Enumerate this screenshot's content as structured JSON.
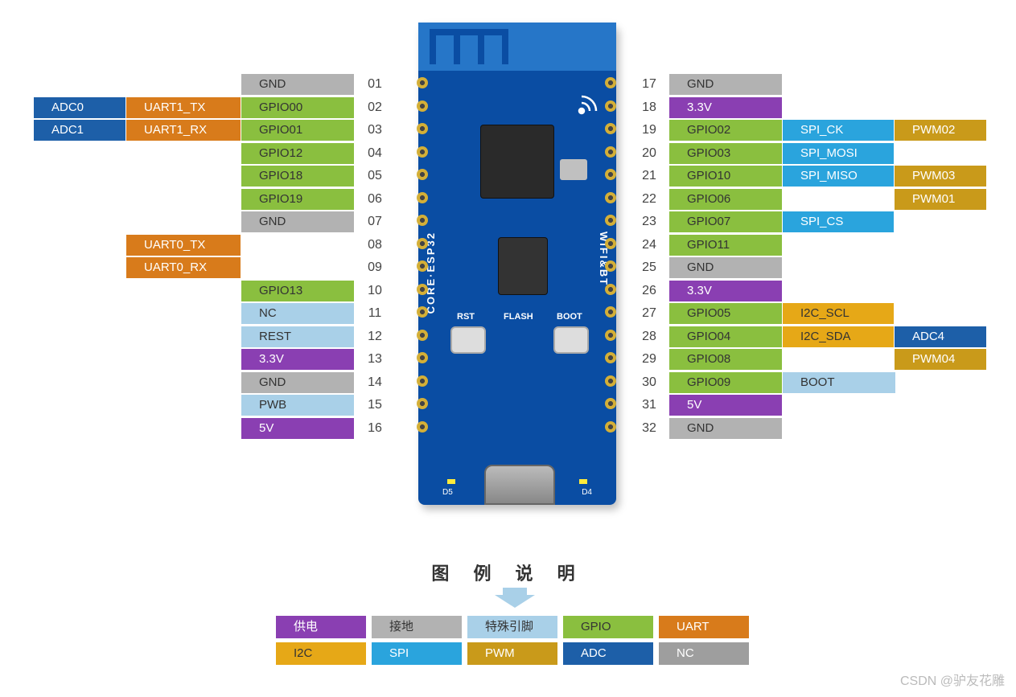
{
  "board": {
    "text_left": "CORE·ESP32",
    "text_right": "WIFI&BT",
    "btn_rst": "RST",
    "btn_flash": "FLASH",
    "btn_boot": "BOOT",
    "led_l": "D5",
    "led_r": "D4"
  },
  "colors": {
    "adc": "#1d5fa8",
    "uart": "#d87b1b",
    "gpio": "#8abf3f",
    "gnd": "#b2b2b2",
    "pwr": "#8a3fb2",
    "spec": "#a9d0e8",
    "i2c": "#e6a817",
    "spi": "#2aa4dd",
    "pwm": "#c99a1a",
    "nc": "#9e9e9e"
  },
  "left_pins": [
    {
      "num": "01",
      "cells": [
        {
          "t": "GND",
          "c": "gnd",
          "dark": true
        }
      ]
    },
    {
      "num": "02",
      "cells": [
        {
          "t": "ADC0",
          "c": "adc"
        },
        {
          "t": "UART1_TX",
          "c": "uart"
        },
        {
          "t": "GPIO00",
          "c": "gpio",
          "dark": true
        }
      ]
    },
    {
      "num": "03",
      "cells": [
        {
          "t": "ADC1",
          "c": "adc"
        },
        {
          "t": "UART1_RX",
          "c": "uart"
        },
        {
          "t": "GPIO01",
          "c": "gpio",
          "dark": true
        }
      ]
    },
    {
      "num": "04",
      "cells": [
        {
          "t": "GPIO12",
          "c": "gpio",
          "dark": true
        }
      ]
    },
    {
      "num": "05",
      "cells": [
        {
          "t": "GPIO18",
          "c": "gpio",
          "dark": true
        }
      ]
    },
    {
      "num": "06",
      "cells": [
        {
          "t": "GPIO19",
          "c": "gpio",
          "dark": true
        }
      ]
    },
    {
      "num": "07",
      "cells": [
        {
          "t": "GND",
          "c": "gnd",
          "dark": true
        }
      ]
    },
    {
      "num": "08",
      "cells": [
        {
          "t": "UART0_TX",
          "c": "uart"
        }
      ]
    },
    {
      "num": "09",
      "cells": [
        {
          "t": "UART0_RX",
          "c": "uart"
        }
      ]
    },
    {
      "num": "10",
      "cells": [
        {
          "t": "GPIO13",
          "c": "gpio",
          "dark": true
        }
      ]
    },
    {
      "num": "11",
      "cells": [
        {
          "t": "NC",
          "c": "spec",
          "dark": true
        }
      ]
    },
    {
      "num": "12",
      "cells": [
        {
          "t": "REST",
          "c": "spec",
          "dark": true
        }
      ]
    },
    {
      "num": "13",
      "cells": [
        {
          "t": "3.3V",
          "c": "pwr"
        }
      ]
    },
    {
      "num": "14",
      "cells": [
        {
          "t": "GND",
          "c": "gnd",
          "dark": true
        }
      ]
    },
    {
      "num": "15",
      "cells": [
        {
          "t": "PWB",
          "c": "spec",
          "dark": true
        }
      ]
    },
    {
      "num": "16",
      "cells": [
        {
          "t": "5V",
          "c": "pwr"
        }
      ]
    }
  ],
  "right_pins": [
    {
      "num": "17",
      "cells": [
        {
          "t": "GND",
          "c": "gnd",
          "dark": true
        }
      ]
    },
    {
      "num": "18",
      "cells": [
        {
          "t": "3.3V",
          "c": "pwr"
        }
      ]
    },
    {
      "num": "19",
      "cells": [
        {
          "t": "GPIO02",
          "c": "gpio",
          "dark": true
        },
        {
          "t": "SPI_CK",
          "c": "spi"
        },
        {
          "t": "PWM02",
          "c": "pwm"
        }
      ]
    },
    {
      "num": "20",
      "cells": [
        {
          "t": "GPIO03",
          "c": "gpio",
          "dark": true
        },
        {
          "t": "SPI_MOSI",
          "c": "spi"
        }
      ]
    },
    {
      "num": "21",
      "cells": [
        {
          "t": "GPIO10",
          "c": "gpio",
          "dark": true
        },
        {
          "t": "SPI_MISO",
          "c": "spi"
        },
        {
          "t": "PWM03",
          "c": "pwm"
        }
      ]
    },
    {
      "num": "22",
      "cells": [
        {
          "t": "GPIO06",
          "c": "gpio",
          "dark": true
        },
        {
          "t": "",
          "c": "gpio",
          "blank": true
        },
        {
          "t": "PWM01",
          "c": "pwm"
        }
      ]
    },
    {
      "num": "23",
      "cells": [
        {
          "t": "GPIO07",
          "c": "gpio",
          "dark": true
        },
        {
          "t": "SPI_CS",
          "c": "spi"
        }
      ]
    },
    {
      "num": "24",
      "cells": [
        {
          "t": "GPIO11",
          "c": "gpio",
          "dark": true
        }
      ]
    },
    {
      "num": "25",
      "cells": [
        {
          "t": "GND",
          "c": "gnd",
          "dark": true
        }
      ]
    },
    {
      "num": "26",
      "cells": [
        {
          "t": "3.3V",
          "c": "pwr"
        }
      ]
    },
    {
      "num": "27",
      "cells": [
        {
          "t": "GPIO05",
          "c": "gpio",
          "dark": true
        },
        {
          "t": "I2C_SCL",
          "c": "i2c",
          "dark": true
        }
      ]
    },
    {
      "num": "28",
      "cells": [
        {
          "t": "GPIO04",
          "c": "gpio",
          "dark": true
        },
        {
          "t": "I2C_SDA",
          "c": "i2c",
          "dark": true
        },
        {
          "t": "ADC4",
          "c": "adc"
        }
      ]
    },
    {
      "num": "29",
      "cells": [
        {
          "t": "GPIO08",
          "c": "gpio",
          "dark": true
        },
        {
          "t": "",
          "blank": true
        },
        {
          "t": "PWM04",
          "c": "pwm"
        }
      ]
    },
    {
      "num": "30",
      "cells": [
        {
          "t": "GPIO09",
          "c": "gpio",
          "dark": true
        },
        {
          "t": "BOOT",
          "c": "spec",
          "dark": true
        }
      ]
    },
    {
      "num": "31",
      "cells": [
        {
          "t": "5V",
          "c": "pwr"
        }
      ]
    },
    {
      "num": "32",
      "cells": [
        {
          "t": "GND",
          "c": "gnd",
          "dark": true
        }
      ]
    }
  ],
  "legend": {
    "title": "图 例 说 明",
    "row1": [
      {
        "t": "供电",
        "c": "pwr"
      },
      {
        "t": "接地",
        "c": "gnd",
        "dark": true
      },
      {
        "t": "特殊引脚",
        "c": "spec",
        "dark": true
      },
      {
        "t": "GPIO",
        "c": "gpio",
        "dark": true
      },
      {
        "t": "UART",
        "c": "uart"
      }
    ],
    "row2": [
      {
        "t": "I2C",
        "c": "i2c",
        "dark": true
      },
      {
        "t": "SPI",
        "c": "spi"
      },
      {
        "t": "PWM",
        "c": "pwm"
      },
      {
        "t": "ADC",
        "c": "adc"
      },
      {
        "t": "NC",
        "c": "nc"
      }
    ]
  },
  "watermark": "CSDN @驴友花雕"
}
